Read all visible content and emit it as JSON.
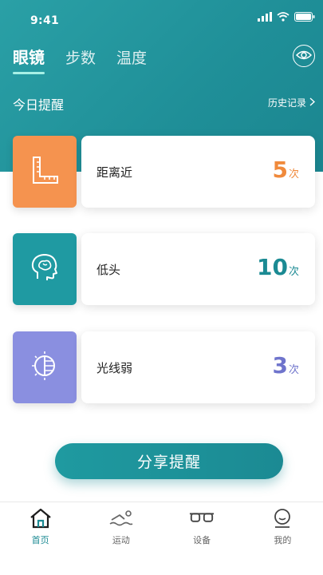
{
  "status_bar": {
    "time": "9:41"
  },
  "header": {
    "tabs": [
      {
        "label": "眼镜",
        "active": true
      },
      {
        "label": "步数",
        "active": false
      },
      {
        "label": "温度",
        "active": false
      }
    ],
    "eye_button_icon": "eye-icon"
  },
  "section": {
    "title": "今日提醒",
    "history_label": "历史记录"
  },
  "reminders": [
    {
      "label": "距离近",
      "count": "5",
      "unit": "次",
      "icon": "ruler-icon",
      "icon_bg": "#f5934f",
      "count_color": "#f08a3c"
    },
    {
      "label": "低头",
      "count": "10",
      "unit": "次",
      "icon": "head-icon",
      "icon_bg": "#1f9aa2",
      "count_color": "#1b8a93"
    },
    {
      "label": "光线弱",
      "count": "3",
      "unit": "次",
      "icon": "light-icon",
      "icon_bg": "#8a8fe0",
      "count_color": "#6f74cc"
    }
  ],
  "share_button": {
    "label": "分享提醒"
  },
  "tabbar": {
    "items": [
      {
        "label": "首页",
        "icon": "home-icon",
        "active": true
      },
      {
        "label": "运动",
        "icon": "swim-icon",
        "active": false
      },
      {
        "label": "设备",
        "icon": "glasses-icon",
        "active": false
      },
      {
        "label": "我的",
        "icon": "profile-icon",
        "active": false
      }
    ]
  },
  "colors": {
    "primary": "#1b8a93",
    "header_bg": "#2aa0a6"
  }
}
